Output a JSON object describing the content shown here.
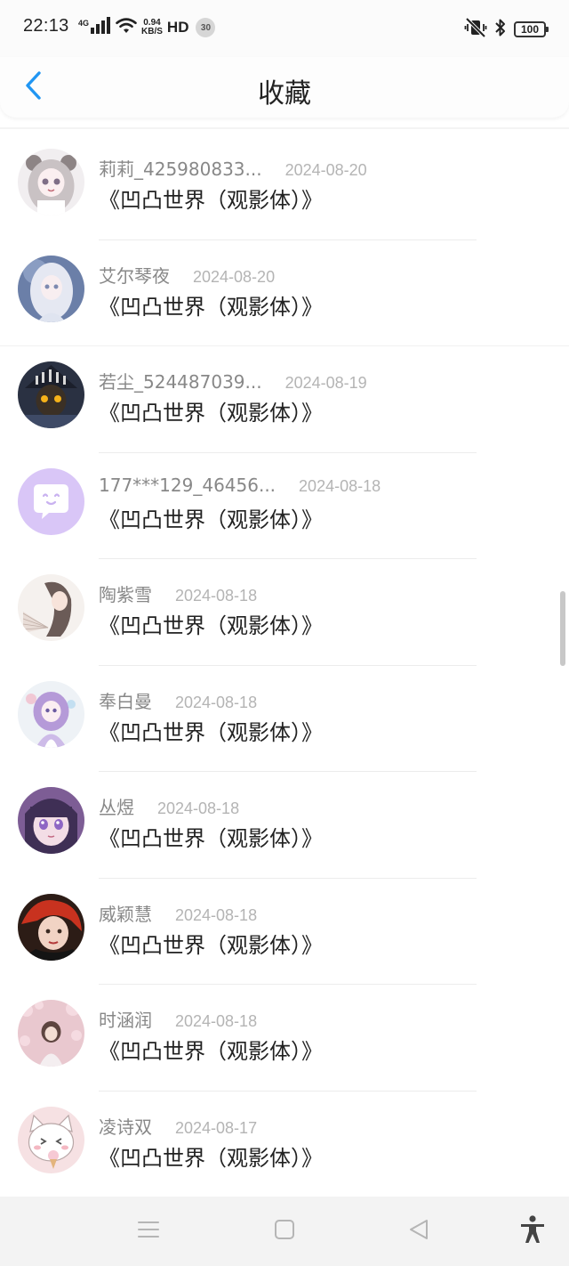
{
  "status_bar": {
    "time": "22:13",
    "network": "4G",
    "speed_value": "0.94",
    "speed_unit": "KB/S",
    "hd": "HD",
    "notification_count": "30",
    "battery": "100"
  },
  "header": {
    "title": "收藏",
    "back_icon": "chevron-left-icon",
    "accent_color": "#2196f3"
  },
  "favorites": [
    {
      "username": "莉莉_425980833...",
      "date": "2024-08-20",
      "title": "《凹凸世界（观影体）》",
      "avatar": "anime-girl-bear-ears"
    },
    {
      "username": "艾尔琴夜",
      "date": "2024-08-20",
      "title": "《凹凸世界（观影体）》",
      "avatar": "anime-girl-white-hair"
    },
    {
      "username": "若尘_524487039...",
      "date": "2024-08-19",
      "title": "《凹凸世界（观影体）》",
      "avatar": "dark-character-glowing-eyes"
    },
    {
      "username": "177***129_46456...",
      "date": "2024-08-18",
      "title": "《凹凸世界（观影体）》",
      "avatar": "default-chat-bubble"
    },
    {
      "username": "陶紫雪",
      "date": "2024-08-18",
      "title": "《凹凸世界（观影体）》",
      "avatar": "girl-with-fan"
    },
    {
      "username": "奉白曼",
      "date": "2024-08-18",
      "title": "《凹凸世界（观影体）》",
      "avatar": "anime-girl-purple-dress"
    },
    {
      "username": "丛煜",
      "date": "2024-08-18",
      "title": "《凹凸世界（观影体）》",
      "avatar": "anime-girl-purple-eyes"
    },
    {
      "username": "威颖慧",
      "date": "2024-08-18",
      "title": "《凹凸世界（观影体）》",
      "avatar": "woman-red-hair"
    },
    {
      "username": "时涵润",
      "date": "2024-08-18",
      "title": "《凹凸世界（观影体）》",
      "avatar": "girl-cherry-blossoms"
    },
    {
      "username": "凌诗双",
      "date": "2024-08-17",
      "title": "《凹凸世界（观影体）》",
      "avatar": "cartoon-cat-ice-cream"
    }
  ],
  "nav_bar": {
    "icons": [
      "menu-icon",
      "home-square-icon",
      "back-triangle-icon",
      "accessibility-icon"
    ]
  }
}
